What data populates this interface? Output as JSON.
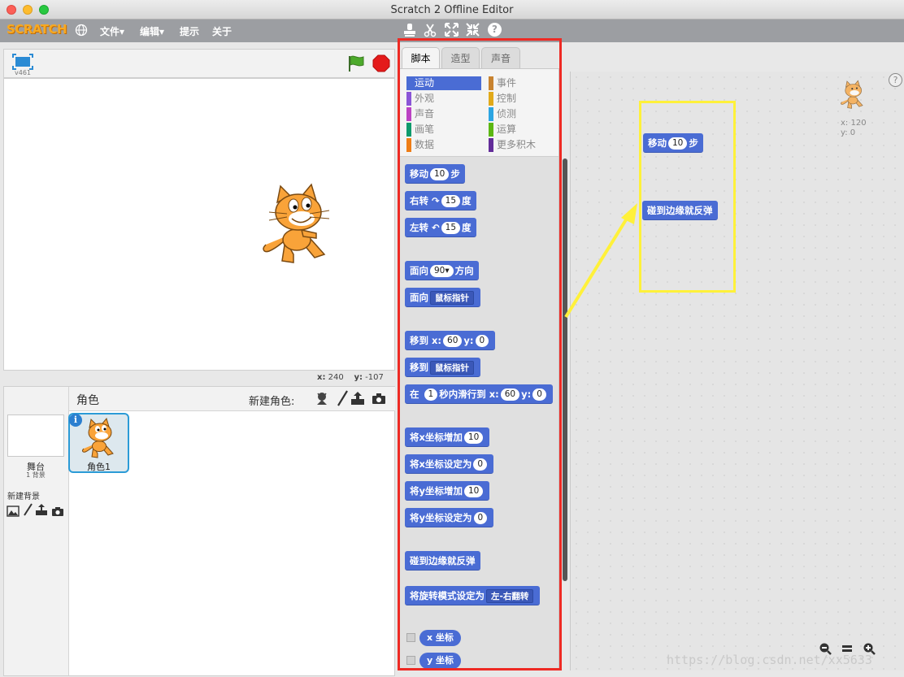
{
  "window": {
    "title": "Scratch 2 Offline Editor"
  },
  "menu": {
    "logo": "SCRATCH",
    "items": [
      "文件▾",
      "编辑▾",
      "提示",
      "关于"
    ]
  },
  "stage": {
    "version": "v461",
    "coords": {
      "x_label": "x:",
      "x_value": "240",
      "y_label": "y:",
      "y_value": "-107"
    }
  },
  "sprites": {
    "header_label": "角色",
    "new_sprite_label": "新建角色:",
    "stage_label": "舞台",
    "stage_backdrops": "1 背景",
    "new_backdrop_label": "新建背景",
    "sprite_name": "角色1"
  },
  "tabs": [
    "脚本",
    "造型",
    "声音"
  ],
  "categories": {
    "left": [
      {
        "label": "运动",
        "color": "#4a6cd4",
        "selected": true
      },
      {
        "label": "外观",
        "color": "#8a55d7"
      },
      {
        "label": "声音",
        "color": "#bb42c3"
      },
      {
        "label": "画笔",
        "color": "#0e9a6c"
      },
      {
        "label": "数据",
        "color": "#ee7d16"
      }
    ],
    "right": [
      {
        "label": "事件",
        "color": "#c88330"
      },
      {
        "label": "控制",
        "color": "#e1a91a"
      },
      {
        "label": "侦测",
        "color": "#2ca5e2"
      },
      {
        "label": "运算",
        "color": "#5cb712"
      },
      {
        "label": "更多积木",
        "color": "#632d99"
      }
    ]
  },
  "blocks": {
    "move": {
      "a": "移动",
      "v": "10",
      "b": "步"
    },
    "turn_right": {
      "a": "右转",
      "icon": "↷",
      "v": "15",
      "b": "度"
    },
    "turn_left": {
      "a": "左转",
      "icon": "↶",
      "v": "15",
      "b": "度"
    },
    "point_dir": {
      "a": "面向",
      "v": "90▾",
      "b": "方向"
    },
    "point_towards": {
      "a": "面向",
      "v": "鼠标指针"
    },
    "goto_xy": {
      "a": "移到",
      "x_label": "x:",
      "x": "60",
      "y_label": "y:",
      "y": "0"
    },
    "goto": {
      "a": "移到",
      "v": "鼠标指针"
    },
    "glide": {
      "a": "在",
      "secs": "1",
      "b": "秒内滑行到",
      "x_label": "x:",
      "x": "60",
      "y_label": "y:",
      "y": "0"
    },
    "change_x": {
      "a": "将x坐标增加",
      "v": "10"
    },
    "set_x": {
      "a": "将x坐标设定为",
      "v": "0"
    },
    "change_y": {
      "a": "将y坐标增加",
      "v": "10"
    },
    "set_y": {
      "a": "将y坐标设定为",
      "v": "0"
    },
    "bounce": {
      "a": "碰到边缘就反弹"
    },
    "rotation_style": {
      "a": "将旋转模式设定为",
      "v": "左-右翻转"
    },
    "x_pos": {
      "a": "x 坐标"
    },
    "y_pos": {
      "a": "y 坐标"
    }
  },
  "scripts": {
    "move": {
      "a": "移动",
      "v": "10",
      "b": "步"
    },
    "bounce": {
      "a": "碰到边缘就反弹"
    },
    "sprite_coords": {
      "x": "x: 120",
      "y": "y: 0"
    }
  },
  "watermark": "https://blog.csdn.net/xx5633",
  "colors": {
    "motion": "#4a6cd4",
    "annotation_red": "#ee2a24",
    "annotation_yellow": "#fff13a"
  }
}
